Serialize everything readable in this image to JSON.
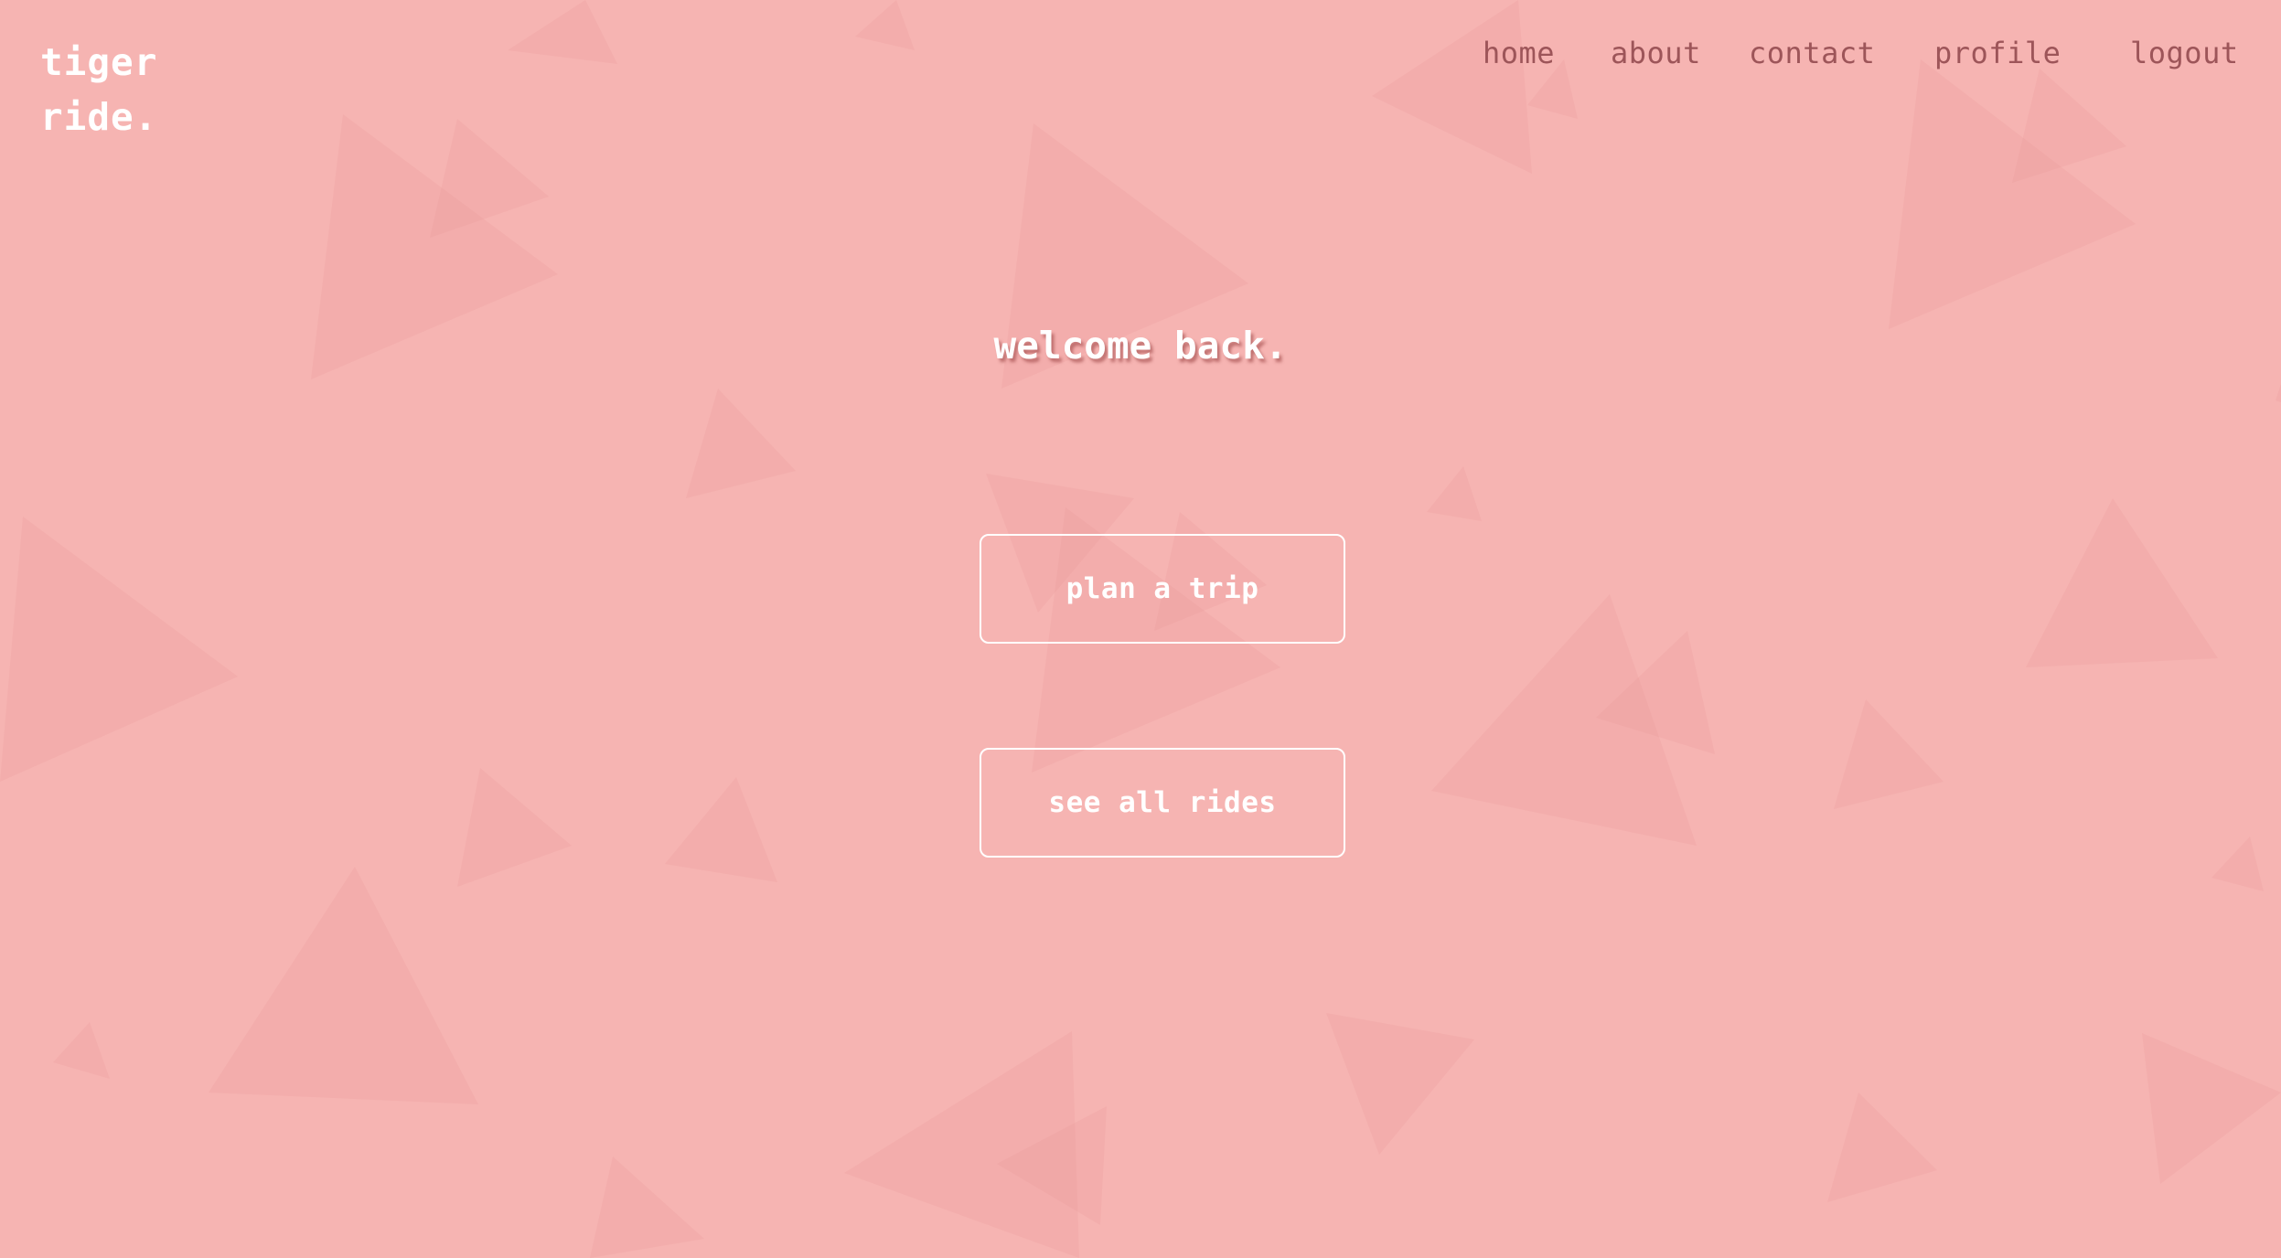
{
  "header": {
    "logo_line1": "tiger",
    "logo_line2": "ride."
  },
  "nav": {
    "home": "home",
    "about": "about",
    "contact": "contact",
    "profile": "profile",
    "logout": "logout"
  },
  "main": {
    "welcome": "welcome back.",
    "plan_trip_label": "plan a trip",
    "see_rides_label": "see all rides"
  },
  "colors": {
    "background": "#f6b4b2",
    "triangle": "#e89497",
    "nav_text": "#9d5559",
    "text": "#ffffff"
  }
}
